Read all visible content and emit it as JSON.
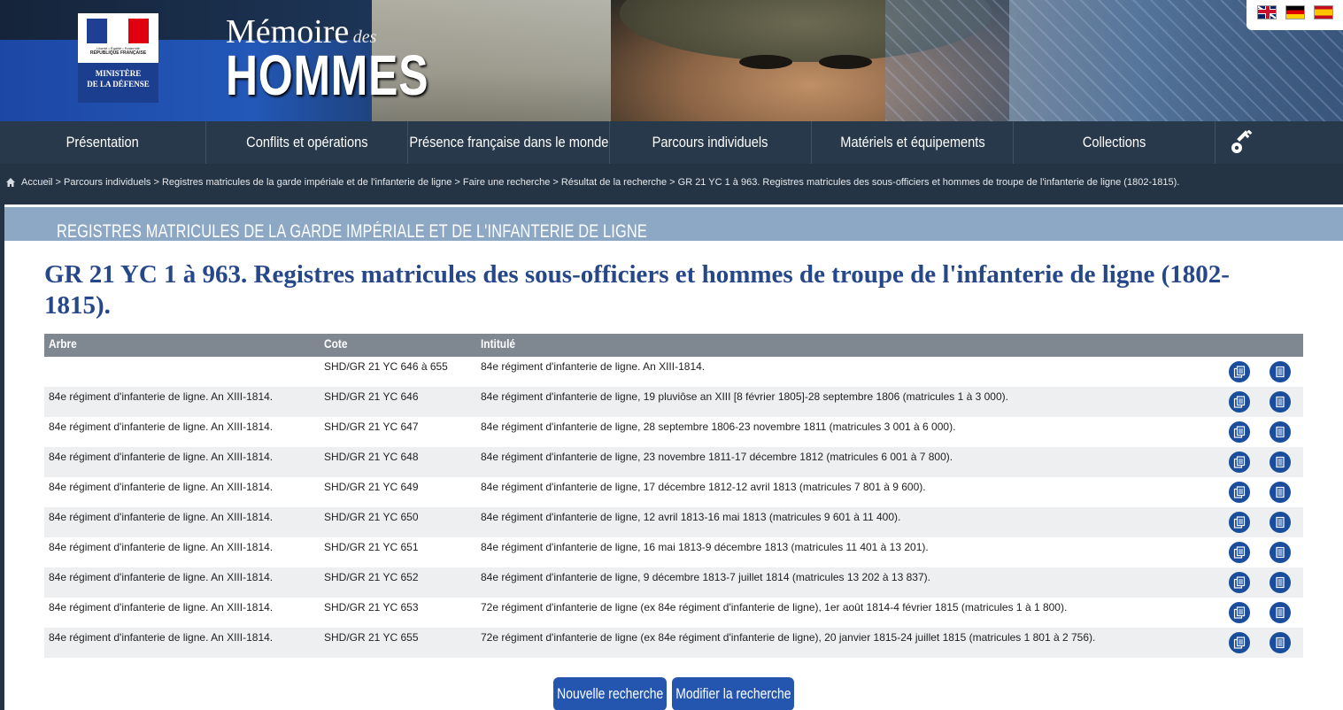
{
  "ministry": {
    "motto": "Liberté • Égalité • Fraternité",
    "republic": "RÉPUBLIQUE FRANÇAISE",
    "line1": "MINISTÈRE",
    "line2": "DE LA DÉFENSE"
  },
  "site": {
    "memoire": "Mémoire",
    "des": "des",
    "hommes": "HOMMES"
  },
  "nav": {
    "items": [
      {
        "label": "Présentation"
      },
      {
        "label": "Conflits et opérations"
      },
      {
        "label": "Présence française dans le monde"
      },
      {
        "label": "Parcours individuels"
      },
      {
        "label": "Matériels et équipements"
      },
      {
        "label": "Collections"
      }
    ],
    "key_icon": "key-icon"
  },
  "breadcrumb": "Accueil > Parcours individuels > Registres matricules de la garde impériale et de l'infanterie de ligne > Faire une recherche > Résultat de la recherche > GR 21 YC 1 à 963. Registres matricules des sous-officiers et hommes de troupe de l'infanterie de ligne (1802-1815).",
  "section_title": "REGISTRES MATRICULES DE LA GARDE IMPÉRIALE ET DE L'INFANTERIE DE LIGNE",
  "page_title": "GR 21 YC 1 à 963. Registres matricules des sous-officiers et hommes de troupe de l'infanterie de ligne (1802-1815).",
  "table": {
    "headers": {
      "arbre": "Arbre",
      "cote": "Cote",
      "intitule": "Intitulé"
    },
    "rows": [
      {
        "arbre": "",
        "cote": "SHD/GR 21 YC 646 à 655",
        "intitule": "84e régiment d'infanterie de ligne. An XIII-1814."
      },
      {
        "arbre": "84e régiment d'infanterie de ligne. An XIII-1814.",
        "cote": "SHD/GR 21 YC 646",
        "intitule": "84e régiment d'infanterie de ligne, 19 pluviôse an XIII [8 février 1805]-28 septembre 1806 (matricules 1 à 3 000)."
      },
      {
        "arbre": "84e régiment d'infanterie de ligne. An XIII-1814.",
        "cote": "SHD/GR 21 YC 647",
        "intitule": "84e régiment d'infanterie de ligne, 28 septembre 1806-23 novembre 1811 (matricules 3 001 à 6 000)."
      },
      {
        "arbre": "84e régiment d'infanterie de ligne. An XIII-1814.",
        "cote": "SHD/GR 21 YC 648",
        "intitule": "84e régiment d'infanterie de ligne, 23 novembre 1811-17 décembre 1812 (matricules 6 001 à 7 800)."
      },
      {
        "arbre": "84e régiment d'infanterie de ligne. An XIII-1814.",
        "cote": "SHD/GR 21 YC 649",
        "intitule": "84e régiment d'infanterie de ligne, 17 décembre 1812-12 avril 1813 (matricules 7 801 à 9 600)."
      },
      {
        "arbre": "84e régiment d'infanterie de ligne. An XIII-1814.",
        "cote": "SHD/GR 21 YC 650",
        "intitule": "84e régiment d'infanterie de ligne, 12 avril 1813-16 mai 1813 (matricules 9 601 à 11 400)."
      },
      {
        "arbre": "84e régiment d'infanterie de ligne. An XIII-1814.",
        "cote": "SHD/GR 21 YC 651",
        "intitule": "84e régiment d'infanterie de ligne, 16 mai 1813-9 décembre 1813 (matricules 11 401 à 13 201)."
      },
      {
        "arbre": "84e régiment d'infanterie de ligne. An XIII-1814.",
        "cote": "SHD/GR 21 YC 652",
        "intitule": "84e régiment d'infanterie de ligne, 9 décembre 1813-7 juillet 1814 (matricules 13 202 à 13 837)."
      },
      {
        "arbre": "84e régiment d'infanterie de ligne. An XIII-1814.",
        "cote": "SHD/GR 21 YC 653",
        "intitule": "72e régiment d'infanterie de ligne (ex 84e régiment d'infanterie de ligne), 1er août 1814-4 février 1815 (matricules 1 à 1 800)."
      },
      {
        "arbre": "84e régiment d'infanterie de ligne. An XIII-1814.",
        "cote": "SHD/GR 21 YC 655",
        "intitule": "72e régiment d'infanterie de ligne (ex 84e régiment d'infanterie de ligne), 20 janvier 1815-24 juillet 1815 (matricules 1 801 à 2 756)."
      }
    ]
  },
  "buttons": {
    "new_search": "Nouvelle recherche",
    "modify_search": "Modifier la recherche"
  },
  "colors": {
    "title_blue": "#26488a",
    "nav_bg": "#27394a",
    "button_blue": "#2456b0",
    "banner_blue": "#8da8c4"
  }
}
